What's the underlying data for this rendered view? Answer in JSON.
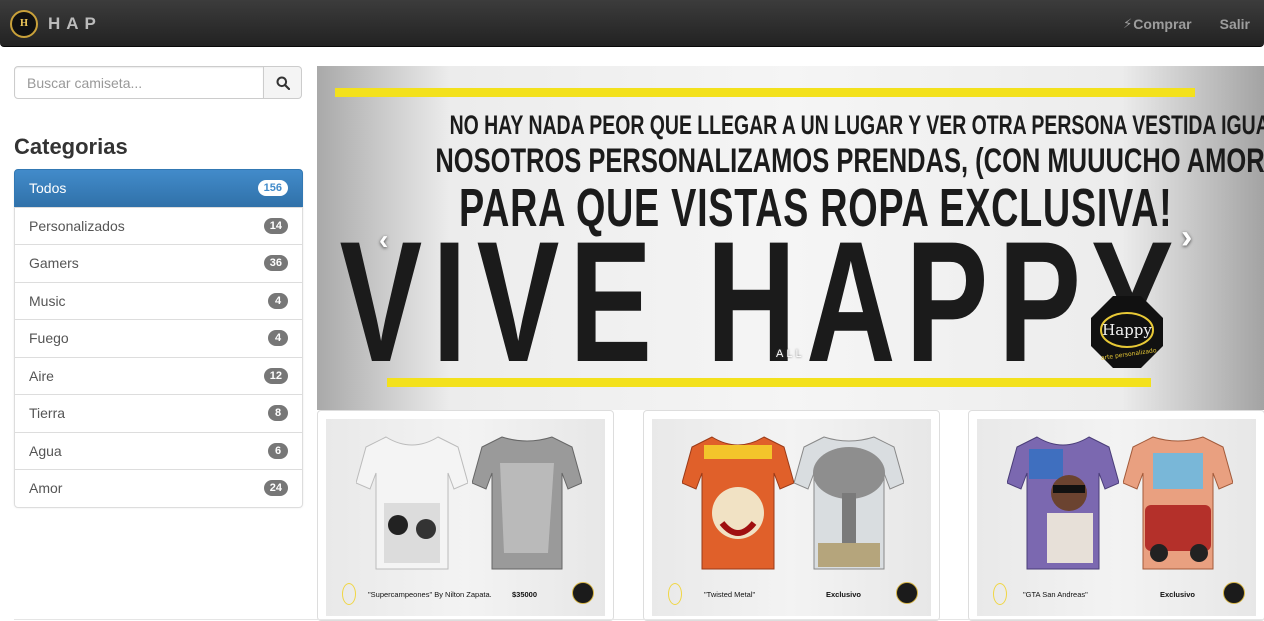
{
  "navbar": {
    "brand_logo_text": "H",
    "brand": "HAP",
    "links": [
      {
        "label": "Comprar",
        "icon": "bolt-icon"
      },
      {
        "label": "Salir"
      }
    ]
  },
  "search": {
    "placeholder": "Buscar camiseta...",
    "button_icon": "search-icon"
  },
  "categories": {
    "title": "Categorias",
    "items": [
      {
        "label": "Todos",
        "count": "156",
        "active": true
      },
      {
        "label": "Personalizados",
        "count": "14"
      },
      {
        "label": "Gamers",
        "count": "36"
      },
      {
        "label": "Music",
        "count": "4"
      },
      {
        "label": "Fuego",
        "count": "4"
      },
      {
        "label": "Aire",
        "count": "12"
      },
      {
        "label": "Tierra",
        "count": "8"
      },
      {
        "label": "Agua",
        "count": "6"
      },
      {
        "label": "Amor",
        "count": "24"
      }
    ]
  },
  "banner": {
    "line1": "NO HAY NADA PEOR QUE LLEGAR A UN LUGAR Y VER OTRA PERSONA VESTIDA IGUAL A TI.",
    "line2": "NOSOTROS PERSONALIZAMOS PRENDAS, (CON MUUUCHO AMOR)",
    "line3": "PARA QUE VISTAS ROPA EXCLUSIVA!",
    "line4": "VIVE HAPPY",
    "seal_text": "Happy",
    "seal_sub": "arte personalizado",
    "indicators": "ALL",
    "prev_icon": "chevron-left-icon",
    "next_icon": "chevron-right-icon",
    "accent": "#f3e11c"
  },
  "products": [
    {
      "name": "\"Supercampeones\" By Nilton Zapata.",
      "price": "$35000",
      "colors": [
        "#f2f2f2",
        "#9a9a9a"
      ]
    },
    {
      "name": "\"Twisted Metal\"",
      "price": "Exclusivo",
      "colors": [
        "#d8542a",
        "#c9c9c9"
      ]
    },
    {
      "name": "\"GTA San Andreas\"",
      "price": "Exclusivo",
      "colors": [
        "#6c5aa3",
        "#d86a45"
      ]
    }
  ]
}
